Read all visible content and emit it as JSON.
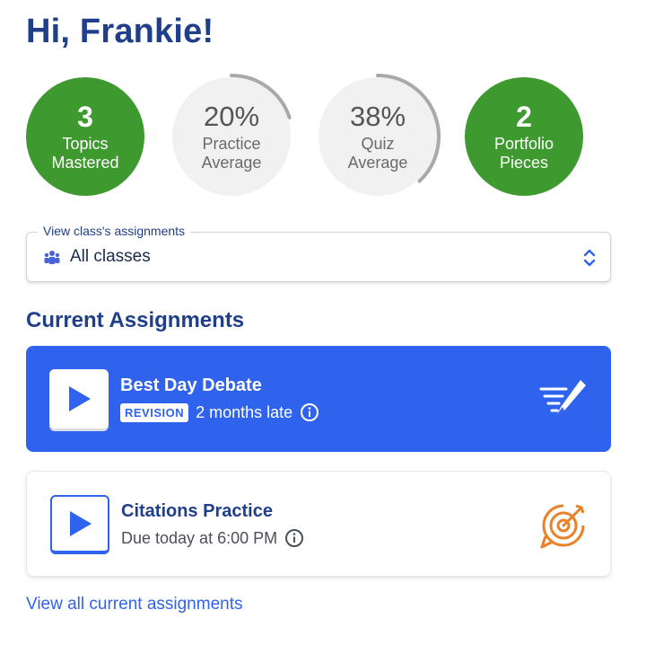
{
  "greeting": "Hi, Frankie!",
  "stats": [
    {
      "value": "3",
      "label_line1": "Topics",
      "label_line2": "Mastered",
      "style": "green"
    },
    {
      "value": "20%",
      "label_line1": "Practice",
      "label_line2": "Average",
      "style": "gray",
      "progress": 0.2
    },
    {
      "value": "38%",
      "label_line1": "Quiz",
      "label_line2": "Average",
      "style": "gray",
      "progress": 0.38
    },
    {
      "value": "2",
      "label_line1": "Portfolio",
      "label_line2": "Pieces",
      "style": "green"
    }
  ],
  "class_selector": {
    "legend": "View class's assignments",
    "value": "All classes",
    "icon": "group-icon"
  },
  "section_title": "Current Assignments",
  "assignments": [
    {
      "title": "Best Day Debate",
      "badge": "REVISION",
      "status": "2 months late",
      "icon": "writing-icon",
      "active": true
    },
    {
      "title": "Citations Practice",
      "status": "Due today at 6:00 PM",
      "icon": "target-icon",
      "active": false
    }
  ],
  "view_all_link": "View all current assignments",
  "colors": {
    "primary": "#2f63ee",
    "heading": "#1f3f8a",
    "green": "#3e9a2e",
    "orange": "#e9822b"
  }
}
